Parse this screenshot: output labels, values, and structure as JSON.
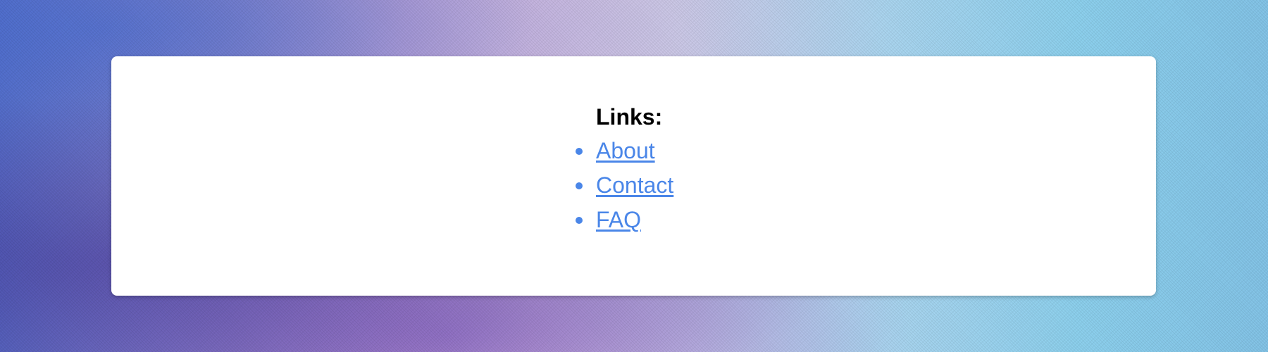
{
  "links": {
    "heading": "Links:",
    "items": [
      {
        "label": "About"
      },
      {
        "label": "Contact"
      },
      {
        "label": "FAQ"
      }
    ]
  },
  "colors": {
    "link": "#4a86e8",
    "card": "#ffffff",
    "heading": "#000000"
  }
}
